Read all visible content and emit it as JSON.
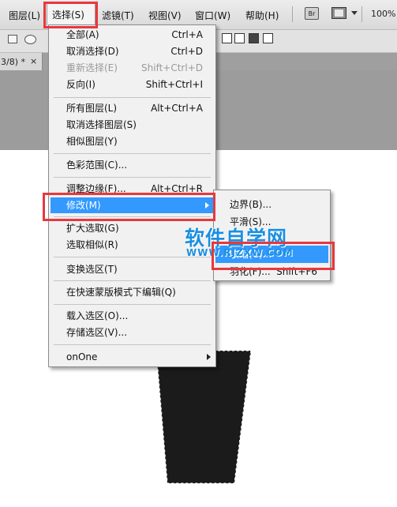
{
  "menubar": {
    "items": [
      "图层(L)",
      "选择(S)",
      "滤镜(T)",
      "视图(V)",
      "窗口(W)",
      "帮助(H)"
    ],
    "bridge_label": "Br",
    "zoom": "100%"
  },
  "doc_tab": {
    "title": "3/8) *",
    "close": "×"
  },
  "select_menu": {
    "items": [
      {
        "label": "全部(A)",
        "shortcut": "Ctrl+A"
      },
      {
        "label": "取消选择(D)",
        "shortcut": "Ctrl+D"
      },
      {
        "label": "重新选择(E)",
        "shortcut": "Shift+Ctrl+D"
      },
      {
        "label": "反向(I)",
        "shortcut": "Shift+Ctrl+I"
      },
      {
        "label": "所有图层(L)",
        "shortcut": "Alt+Ctrl+A"
      },
      {
        "label": "取消选择图层(S)",
        "shortcut": ""
      },
      {
        "label": "相似图层(Y)",
        "shortcut": ""
      },
      {
        "label": "色彩范围(C)...",
        "shortcut": ""
      },
      {
        "label": "调整边缘(F)...",
        "shortcut": "Alt+Ctrl+R"
      },
      {
        "label": "修改(M)",
        "shortcut": ""
      },
      {
        "label": "扩大选取(G)",
        "shortcut": ""
      },
      {
        "label": "选取相似(R)",
        "shortcut": ""
      },
      {
        "label": "变换选区(T)",
        "shortcut": ""
      },
      {
        "label": "在快速蒙版模式下编辑(Q)",
        "shortcut": ""
      },
      {
        "label": "载入选区(O)...",
        "shortcut": ""
      },
      {
        "label": "存储选区(V)...",
        "shortcut": ""
      },
      {
        "label": "onOne",
        "shortcut": ""
      }
    ]
  },
  "modify_submenu": {
    "items": [
      {
        "label": "边界(B)...",
        "shortcut": ""
      },
      {
        "label": "平滑(S)...",
        "shortcut": ""
      },
      {
        "label": "收缩(C)...",
        "shortcut": ""
      },
      {
        "label": "羽化(F)...",
        "shortcut": "Shift+F6"
      }
    ]
  },
  "watermark": {
    "title": "软件自学网",
    "url": "WWW.RJZXW.COM"
  },
  "colors": {
    "highlight": "#3399ff",
    "annotation": "#e8383d",
    "watermark": "#1a8fe0"
  }
}
